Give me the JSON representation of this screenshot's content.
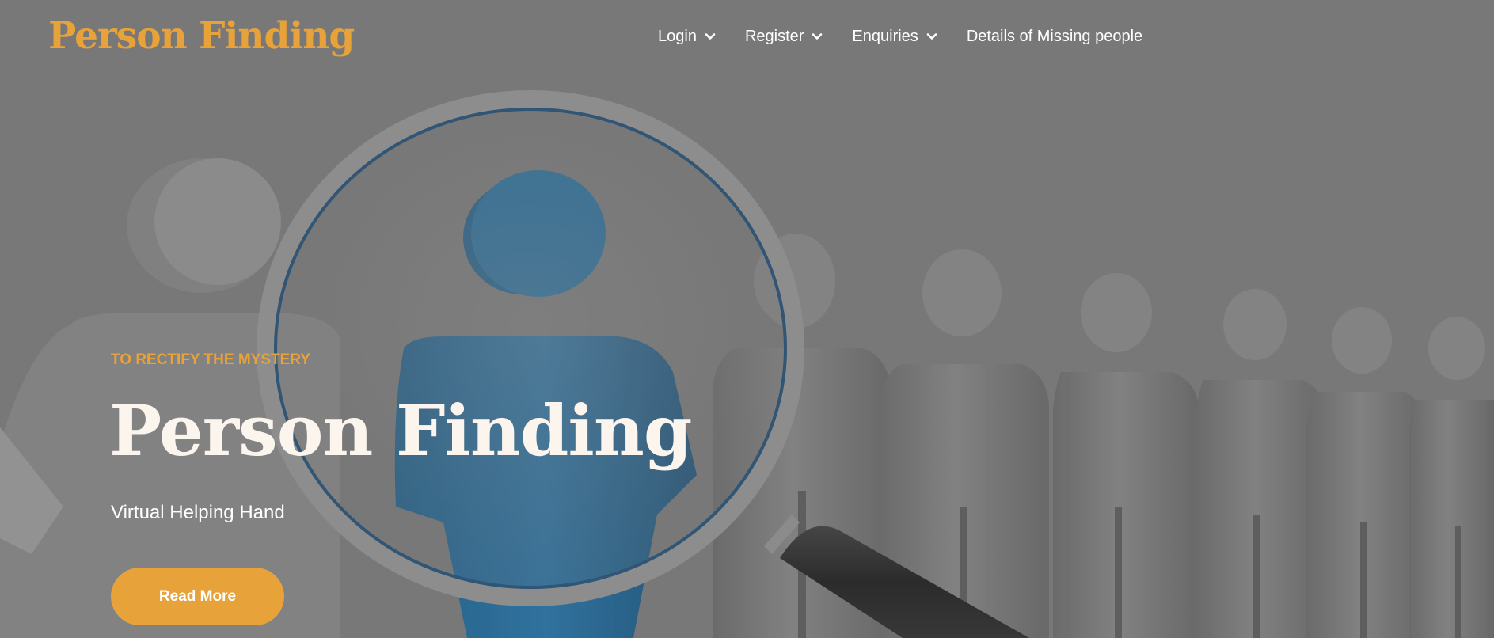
{
  "colors": {
    "accent": "#E8A23A",
    "background": "#7F7F7F"
  },
  "header": {
    "brand": "Person Finding",
    "nav": [
      {
        "label": "Login",
        "icon": "chevron-down-icon"
      },
      {
        "label": "Register",
        "icon": "chevron-down-icon"
      },
      {
        "label": "Enquiries",
        "icon": "chevron-down-icon"
      },
      {
        "label": "Details of Missing people"
      }
    ]
  },
  "hero": {
    "eyebrow": "TO RECTIFY THE MYSTERY",
    "title": "Person Finding",
    "subtitle": "Virtual Helping Hand",
    "button_label": "Read More"
  }
}
